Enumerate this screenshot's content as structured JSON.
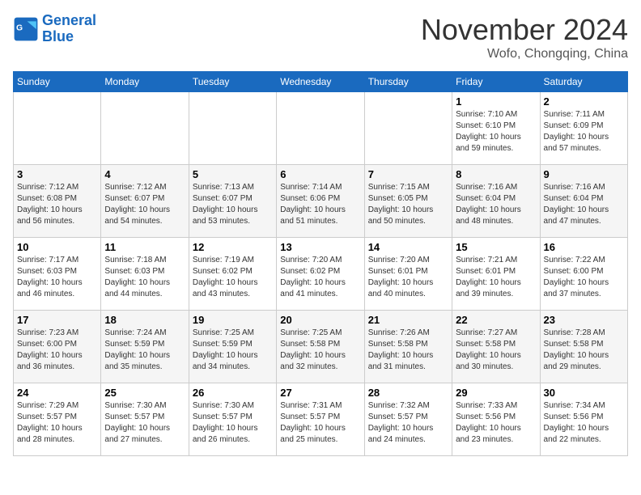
{
  "header": {
    "logo_line1": "General",
    "logo_line2": "Blue",
    "month": "November 2024",
    "location": "Wofo, Chongqing, China"
  },
  "weekdays": [
    "Sunday",
    "Monday",
    "Tuesday",
    "Wednesday",
    "Thursday",
    "Friday",
    "Saturday"
  ],
  "weeks": [
    [
      {
        "day": "",
        "info": ""
      },
      {
        "day": "",
        "info": ""
      },
      {
        "day": "",
        "info": ""
      },
      {
        "day": "",
        "info": ""
      },
      {
        "day": "",
        "info": ""
      },
      {
        "day": "1",
        "info": "Sunrise: 7:10 AM\nSunset: 6:10 PM\nDaylight: 10 hours and 59 minutes."
      },
      {
        "day": "2",
        "info": "Sunrise: 7:11 AM\nSunset: 6:09 PM\nDaylight: 10 hours and 57 minutes."
      }
    ],
    [
      {
        "day": "3",
        "info": "Sunrise: 7:12 AM\nSunset: 6:08 PM\nDaylight: 10 hours and 56 minutes."
      },
      {
        "day": "4",
        "info": "Sunrise: 7:12 AM\nSunset: 6:07 PM\nDaylight: 10 hours and 54 minutes."
      },
      {
        "day": "5",
        "info": "Sunrise: 7:13 AM\nSunset: 6:07 PM\nDaylight: 10 hours and 53 minutes."
      },
      {
        "day": "6",
        "info": "Sunrise: 7:14 AM\nSunset: 6:06 PM\nDaylight: 10 hours and 51 minutes."
      },
      {
        "day": "7",
        "info": "Sunrise: 7:15 AM\nSunset: 6:05 PM\nDaylight: 10 hours and 50 minutes."
      },
      {
        "day": "8",
        "info": "Sunrise: 7:16 AM\nSunset: 6:04 PM\nDaylight: 10 hours and 48 minutes."
      },
      {
        "day": "9",
        "info": "Sunrise: 7:16 AM\nSunset: 6:04 PM\nDaylight: 10 hours and 47 minutes."
      }
    ],
    [
      {
        "day": "10",
        "info": "Sunrise: 7:17 AM\nSunset: 6:03 PM\nDaylight: 10 hours and 46 minutes."
      },
      {
        "day": "11",
        "info": "Sunrise: 7:18 AM\nSunset: 6:03 PM\nDaylight: 10 hours and 44 minutes."
      },
      {
        "day": "12",
        "info": "Sunrise: 7:19 AM\nSunset: 6:02 PM\nDaylight: 10 hours and 43 minutes."
      },
      {
        "day": "13",
        "info": "Sunrise: 7:20 AM\nSunset: 6:02 PM\nDaylight: 10 hours and 41 minutes."
      },
      {
        "day": "14",
        "info": "Sunrise: 7:20 AM\nSunset: 6:01 PM\nDaylight: 10 hours and 40 minutes."
      },
      {
        "day": "15",
        "info": "Sunrise: 7:21 AM\nSunset: 6:01 PM\nDaylight: 10 hours and 39 minutes."
      },
      {
        "day": "16",
        "info": "Sunrise: 7:22 AM\nSunset: 6:00 PM\nDaylight: 10 hours and 37 minutes."
      }
    ],
    [
      {
        "day": "17",
        "info": "Sunrise: 7:23 AM\nSunset: 6:00 PM\nDaylight: 10 hours and 36 minutes."
      },
      {
        "day": "18",
        "info": "Sunrise: 7:24 AM\nSunset: 5:59 PM\nDaylight: 10 hours and 35 minutes."
      },
      {
        "day": "19",
        "info": "Sunrise: 7:25 AM\nSunset: 5:59 PM\nDaylight: 10 hours and 34 minutes."
      },
      {
        "day": "20",
        "info": "Sunrise: 7:25 AM\nSunset: 5:58 PM\nDaylight: 10 hours and 32 minutes."
      },
      {
        "day": "21",
        "info": "Sunrise: 7:26 AM\nSunset: 5:58 PM\nDaylight: 10 hours and 31 minutes."
      },
      {
        "day": "22",
        "info": "Sunrise: 7:27 AM\nSunset: 5:58 PM\nDaylight: 10 hours and 30 minutes."
      },
      {
        "day": "23",
        "info": "Sunrise: 7:28 AM\nSunset: 5:58 PM\nDaylight: 10 hours and 29 minutes."
      }
    ],
    [
      {
        "day": "24",
        "info": "Sunrise: 7:29 AM\nSunset: 5:57 PM\nDaylight: 10 hours and 28 minutes."
      },
      {
        "day": "25",
        "info": "Sunrise: 7:30 AM\nSunset: 5:57 PM\nDaylight: 10 hours and 27 minutes."
      },
      {
        "day": "26",
        "info": "Sunrise: 7:30 AM\nSunset: 5:57 PM\nDaylight: 10 hours and 26 minutes."
      },
      {
        "day": "27",
        "info": "Sunrise: 7:31 AM\nSunset: 5:57 PM\nDaylight: 10 hours and 25 minutes."
      },
      {
        "day": "28",
        "info": "Sunrise: 7:32 AM\nSunset: 5:57 PM\nDaylight: 10 hours and 24 minutes."
      },
      {
        "day": "29",
        "info": "Sunrise: 7:33 AM\nSunset: 5:56 PM\nDaylight: 10 hours and 23 minutes."
      },
      {
        "day": "30",
        "info": "Sunrise: 7:34 AM\nSunset: 5:56 PM\nDaylight: 10 hours and 22 minutes."
      }
    ]
  ]
}
